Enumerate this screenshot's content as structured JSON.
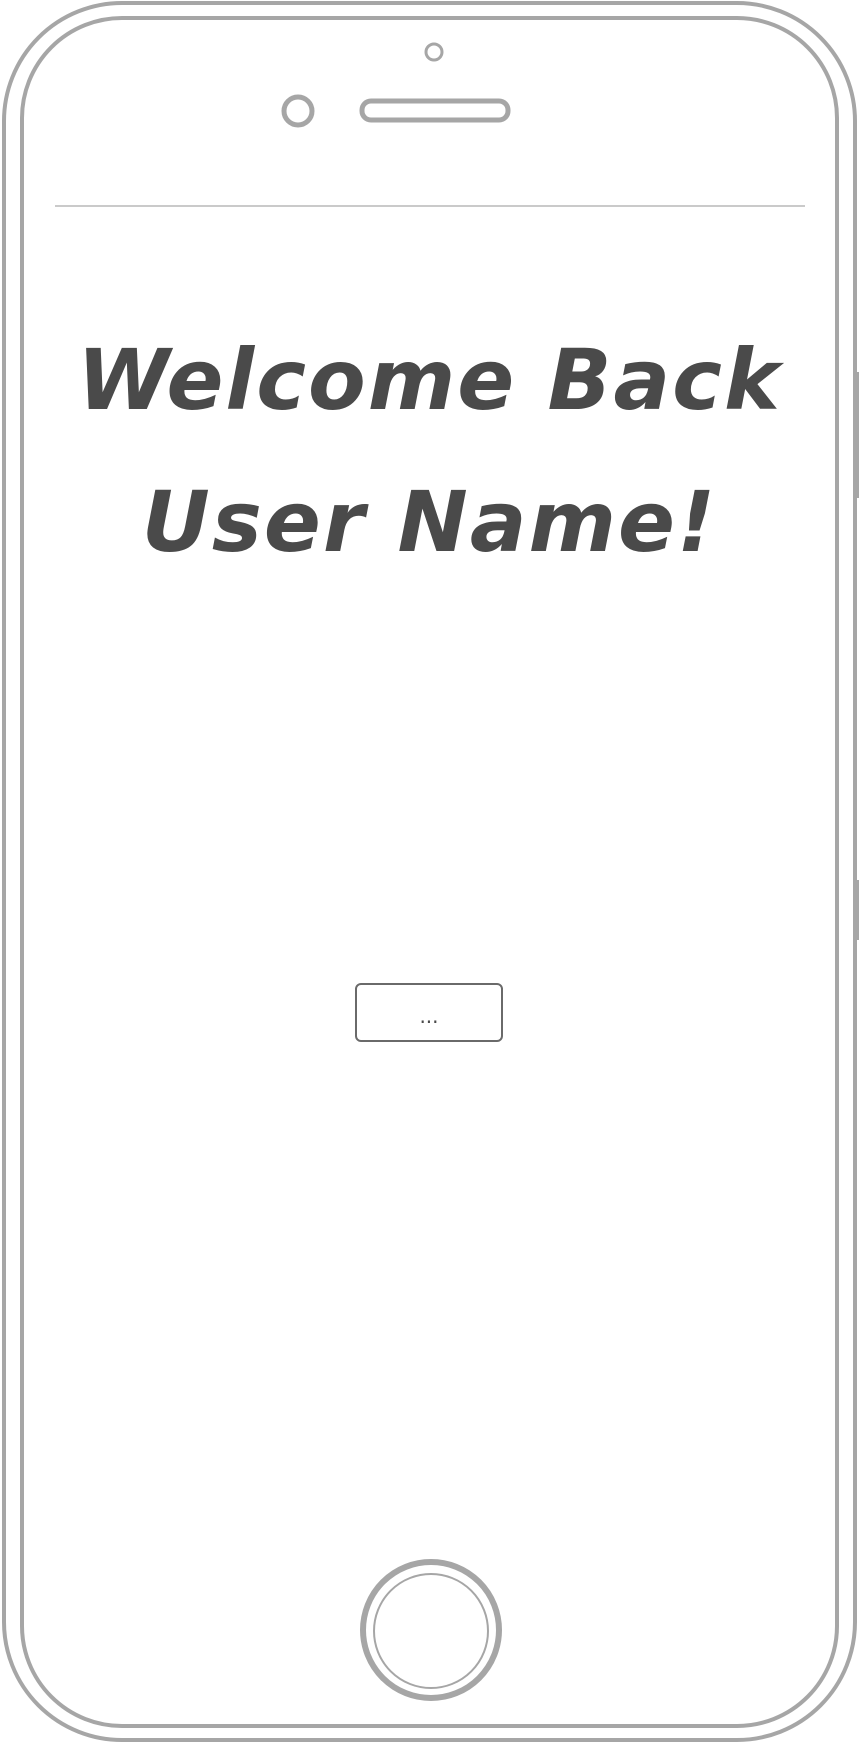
{
  "screen": {
    "welcome_line_1": "Welcome Back",
    "welcome_line_2": "User Name!",
    "action_button_label": "..."
  },
  "colors": {
    "device_outline": "#a6a6a6",
    "text": "#4a4a4a",
    "button_border": "#6a6a6a"
  }
}
